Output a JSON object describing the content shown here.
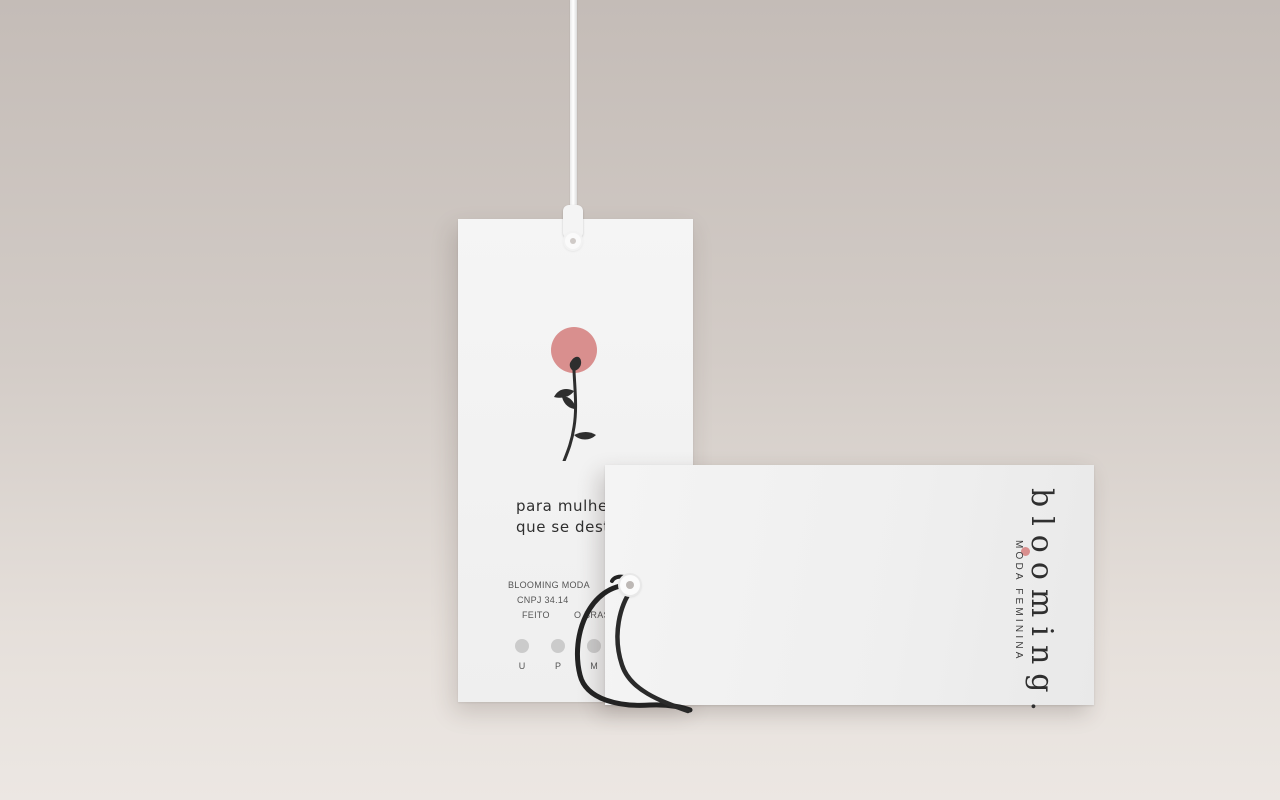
{
  "scene": {
    "back_tag": {
      "tagline_line1": "para mulhe",
      "tagline_line2": "que se desta",
      "company_line1": "BLOOMING MODA",
      "company_line2": "CNPJ 34.14",
      "company_line3": "FEITO",
      "company_line3b": "O BRAS",
      "sizes": [
        "U",
        "P",
        "M"
      ],
      "accent_color": "#d98f8e"
    },
    "front_tag": {
      "brand_name": "blooming.",
      "brand_subtitle": "MODA FEMININA",
      "accent_color": "#d98f8e"
    },
    "icons": {
      "flower": "rose-stem-icon",
      "sun": "pink-circle-icon"
    }
  }
}
